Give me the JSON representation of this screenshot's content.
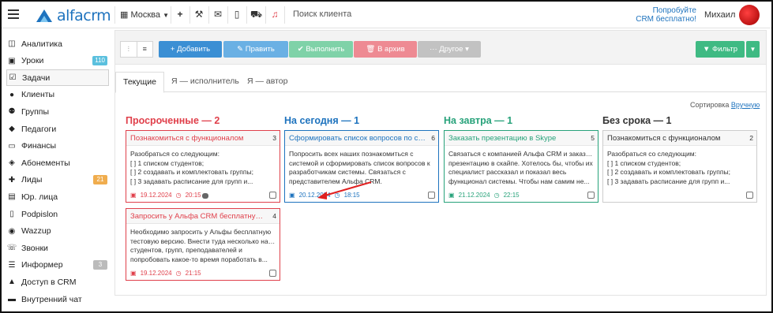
{
  "topbar": {
    "logo_text": "alfacrm",
    "city": "Москва",
    "search_placeholder": "Поиск клиента",
    "try_line1": "Попробуйте",
    "try_line2": "CRM бесплатно!",
    "user_name": "Михаил"
  },
  "sidebar": {
    "items": [
      {
        "label": "Аналитика",
        "icon": "chart-icon"
      },
      {
        "label": "Уроки",
        "icon": "calendar-icon",
        "badge": "110"
      },
      {
        "label": "Задачи",
        "icon": "tasks-icon"
      },
      {
        "label": "Клиенты",
        "icon": "user-icon"
      },
      {
        "label": "Группы",
        "icon": "group-icon"
      },
      {
        "label": "Педагоги",
        "icon": "teacher-icon"
      },
      {
        "label": "Финансы",
        "icon": "money-icon"
      },
      {
        "label": "Абонементы",
        "icon": "tag-icon"
      },
      {
        "label": "Лиды",
        "icon": "user-plus-icon",
        "badge": "21"
      },
      {
        "label": "Юр. лица",
        "icon": "briefcase-icon"
      },
      {
        "label": "Podpislon",
        "icon": "file-icon"
      },
      {
        "label": "Wazzup",
        "icon": "whatsapp-icon"
      },
      {
        "label": "Звонки",
        "icon": "phone-icon"
      },
      {
        "label": "Информер",
        "icon": "list-icon",
        "badge": "3"
      },
      {
        "label": "Доступ в CRM",
        "icon": "lock-icon"
      },
      {
        "label": "Внутренний чат",
        "icon": "chat-icon"
      }
    ]
  },
  "toolbar": {
    "add": "+ Добавить",
    "edit": "✎ Править",
    "done": "✔ Выполнить",
    "archive": "🗑 В архив",
    "other": "··· Другое ▾",
    "filter": "▼ Фильтр"
  },
  "tabs": [
    "Текущие",
    "Я — исполнитель",
    "Я — автор"
  ],
  "sort": {
    "label": "Сортировка",
    "value": "Вручную"
  },
  "columns": [
    {
      "title": "Просроченные — 2",
      "color": "#e0404b",
      "cards": [
        {
          "title": "Познакомиться с функционалом",
          "num": "3",
          "lines": [
            "Разобраться со следующим:",
            "[ ] 1 списком студентов;",
            "[ ] 2 создавать и комплектовать группы;",
            "[ ] 3 задавать расписание для групп и..."
          ],
          "date": "19.12.2024",
          "time": "20:15"
        },
        {
          "title": "Запросить у Альфа CRM бесплатную тесто...",
          "num": "4",
          "lines": [
            "Необходимо запросить у Альфы бесплатную",
            "тестовую версию. Внести туда несколько наших",
            "студентов, групп, преподавателей и",
            "попробовать какое-то время поработать в..."
          ],
          "date": "19.12.2024",
          "time": "21:15"
        }
      ]
    },
    {
      "title": "На сегодня — 1",
      "color": "#1e73be",
      "cards": [
        {
          "title": "Сформировать список вопросов по системе",
          "num": "6",
          "lines": [
            "Попросить всех наших познакомиться с",
            "системой и сформировать список вопросов к",
            "разработчикам системы. Связаться с",
            "представителем Альфа CRM."
          ],
          "date": "20.12.2024",
          "time": "18:15"
        }
      ]
    },
    {
      "title": "На завтра — 1",
      "color": "#27a27a",
      "cards": [
        {
          "title": "Заказать презентацию в Skype",
          "num": "5",
          "lines": [
            "Связаться с компанией Альфа CRM и заказать",
            "презентацию в скайпе. Хотелось бы, чтобы их",
            "специалист рассказал и показал весь",
            "функционал системы. Чтобы нам самим не..."
          ],
          "date": "21.12.2024",
          "time": "22:15"
        }
      ]
    },
    {
      "title": "Без срока — 1",
      "color": "#333333",
      "cards": [
        {
          "title": "Познакомиться с функционалом",
          "num": "2",
          "lines": [
            "Разобраться со следующим:",
            "[ ] 1 списком студентов;",
            "[ ] 2 создавать и комплектовать группы;",
            "[ ] 3 задавать расписание для групп и..."
          ],
          "date": "",
          "time": ""
        }
      ]
    }
  ],
  "colors": {
    "add": "#3b8fd4",
    "edit": "#6ab0e4",
    "done": "#7fd2a8",
    "archive": "#ee8a93",
    "other": "#c2c2c2",
    "filter": "#3fba83",
    "badge_blue": "#5bc0de",
    "badge_orange": "#f0ad4e",
    "badge_gray": "#bbbbbb"
  }
}
